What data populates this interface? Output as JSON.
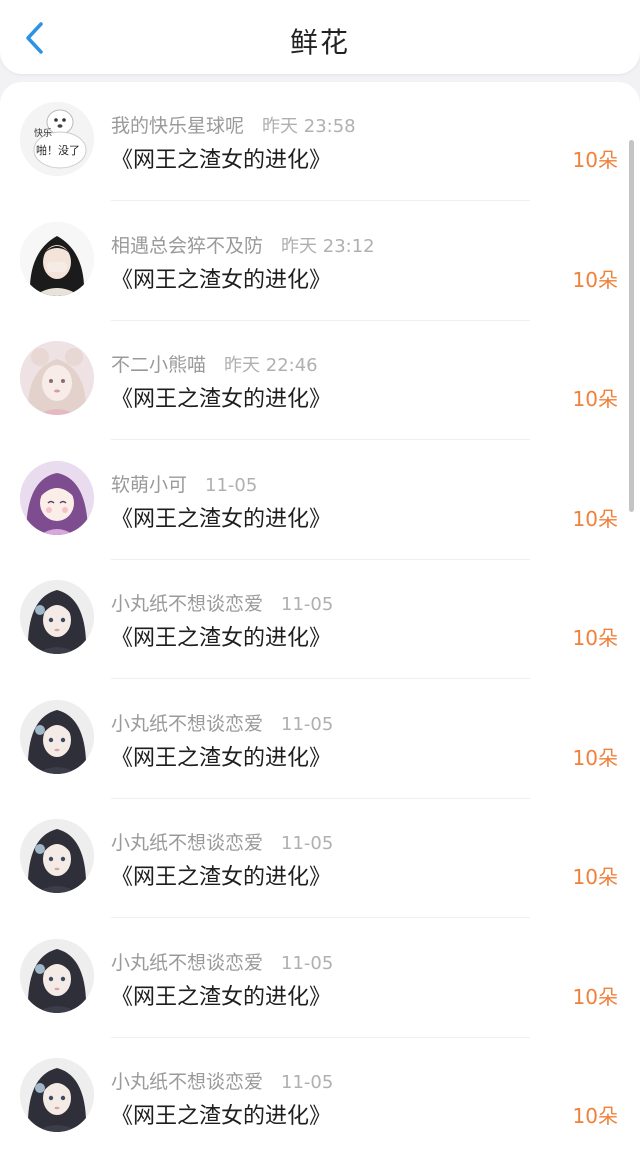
{
  "header": {
    "title": "鲜花",
    "back_icon": "chevron-left-icon",
    "accent_color": "#2d93e6"
  },
  "items": [
    {
      "user": "我的快乐星球呢",
      "time": "昨天 23:58",
      "book": "《网王之渣女的进化》",
      "count": "10朵",
      "avatar": {
        "kind": "dog",
        "text_top": "快乐",
        "text_bottom": "啪！没了"
      }
    },
    {
      "user": "相遇总会猝不及防",
      "time": "昨天 23:12",
      "book": "《网王之渣女的进化》",
      "count": "10朵",
      "avatar": {
        "kind": "girl-dark"
      }
    },
    {
      "user": "不二小熊喵",
      "time": "昨天 22:46",
      "book": "《网王之渣女的进化》",
      "count": "10朵",
      "avatar": {
        "kind": "girl-pink"
      }
    },
    {
      "user": "软萌小可",
      "time": "11-05",
      "book": "《网王之渣女的进化》",
      "count": "10朵",
      "avatar": {
        "kind": "anime-purple"
      }
    },
    {
      "user": "小丸纸不想谈恋爱",
      "time": "11-05",
      "book": "《网王之渣女的进化》",
      "count": "10朵",
      "avatar": {
        "kind": "anime-dark"
      }
    },
    {
      "user": "小丸纸不想谈恋爱",
      "time": "11-05",
      "book": "《网王之渣女的进化》",
      "count": "10朵",
      "avatar": {
        "kind": "anime-dark"
      }
    },
    {
      "user": "小丸纸不想谈恋爱",
      "time": "11-05",
      "book": "《网王之渣女的进化》",
      "count": "10朵",
      "avatar": {
        "kind": "anime-dark"
      }
    },
    {
      "user": "小丸纸不想谈恋爱",
      "time": "11-05",
      "book": "《网王之渣女的进化》",
      "count": "10朵",
      "avatar": {
        "kind": "anime-dark"
      }
    },
    {
      "user": "小丸纸不想谈恋爱",
      "time": "11-05",
      "book": "《网王之渣女的进化》",
      "count": "10朵",
      "avatar": {
        "kind": "anime-dark"
      }
    }
  ],
  "colors": {
    "count": "#f0803a",
    "username": "#9a9a9a",
    "book": "#1e1e1e"
  }
}
